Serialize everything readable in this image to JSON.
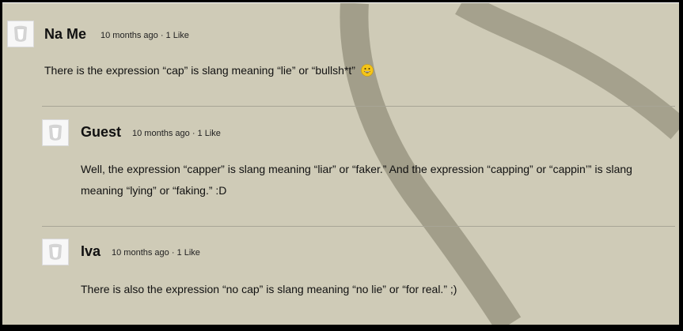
{
  "comments": [
    {
      "author": "Na Me",
      "meta": "10 months ago · 1 Like",
      "text": "There is the expression “cap” is slang meaning “lie” or “bullsh*t”",
      "emoji": "grinning-face-emoji"
    },
    {
      "author": "Guest",
      "meta": "10 months ago · 1 Like",
      "text": "Well, the expression “capper” is slang meaning “liar” or “faker.” And the expression “capping” or “cappin’” is slang meaning “lying” or “faking.” :D"
    },
    {
      "author": "Iva",
      "meta": "10 months ago · 1 Like",
      "text": "There is also the expression “no cap” is slang meaning “no lie” or “for real.” ;)"
    }
  ],
  "colors": {
    "background": "#cfcbb7",
    "stripe": "#8f8b78",
    "divider": "#a8a596",
    "emoji": "#f5c518"
  }
}
